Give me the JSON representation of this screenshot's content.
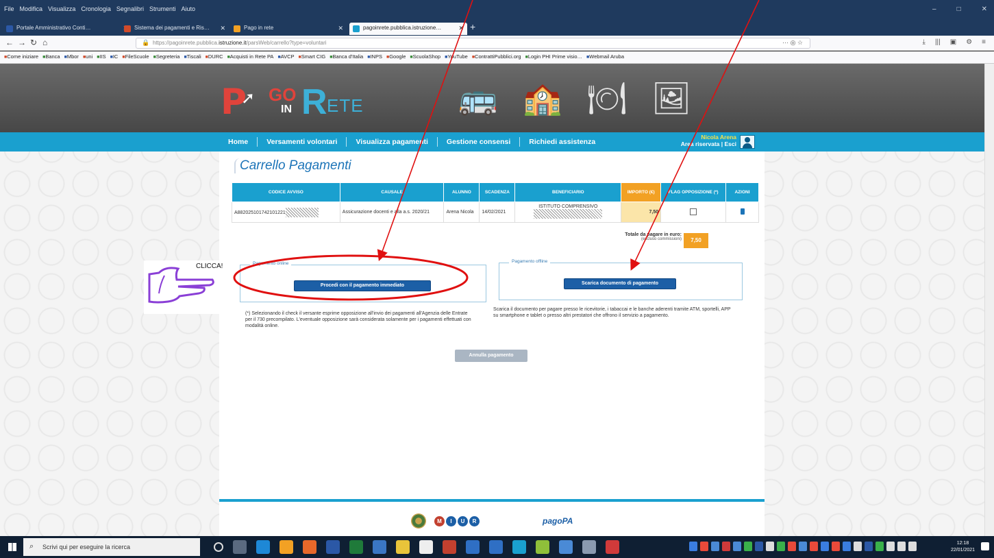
{
  "browser": {
    "menu": [
      "File",
      "Modifica",
      "Visualizza",
      "Cronologia",
      "Segnalibri",
      "Strumenti",
      "Aiuto"
    ],
    "window_controls": [
      "–",
      "□",
      "✕"
    ],
    "tabs": [
      {
        "title": "Portale Amministrativo Conti…",
        "color": "#2b58a6"
      },
      {
        "title": "Sistema dei pagamenti e Ris…",
        "color": "#d04a2a"
      },
      {
        "title": "Pago in rete",
        "color": "#f2a124"
      },
      {
        "title": "pagoinrete.pubblica.istruzione…",
        "color": "#1aa0cf"
      }
    ],
    "url_prefix": "https://pagoinrete.pubblica.",
    "url_host": "istruzione.it",
    "url_path": "/parsWeb/carrello?type=voluntari",
    "url_more": "··· ◎ ☆",
    "nav_right": [
      "⤓",
      "|||",
      "▣",
      "⚙",
      "≡"
    ],
    "bookmarks": [
      "Come iniziare",
      "Banca",
      "Mbor",
      "uni",
      "IIS",
      "IC",
      "FileScuole",
      "Segreteria",
      "Tiscali",
      "DURC",
      "Acquisti in Rete PA",
      "AVCP",
      "Smart CIG",
      "Banca d'Italia",
      "INPS",
      "Google",
      "ScuolaShop",
      "YouTube",
      "ContrattiPubblici.org",
      "Login PHI Prime visio…",
      "Webmail Aruba"
    ]
  },
  "site": {
    "nav": [
      "Home",
      "Versamenti volontari",
      "Visualizza pagamenti",
      "Gestione consensi",
      "Richiedi assistenza"
    ],
    "user_name": "Nicola Arena",
    "user_area": "Area riservata | Esci"
  },
  "cart": {
    "title": "Carrello Pagamenti",
    "columns": [
      "Codice avviso",
      "Causale",
      "Alunno",
      "Scadenza",
      "Beneficiario",
      "Importo (€)",
      "Flag opposizione (*)",
      "Azioni"
    ],
    "rows": [
      {
        "codice": "A882025101742101221",
        "causale": "Assicurazione docenti e alla a.s. 2020/21",
        "alunno": "Arena Nicola",
        "scadenza": "14/02/2021",
        "beneficiario": "ISTITUTO COMPRENSIVO",
        "importo": "7,50"
      }
    ],
    "total_label": "Totale da pagare in euro:",
    "total_note": "(escluso commissioni)",
    "total_value": "7,50"
  },
  "payment": {
    "online_legend": "Pagamento online",
    "online_button": "Procedi con il pagamento immediato",
    "online_text": "(*) Selezionando il check il versante esprime opposizione all'invio dei pagamenti all'Agenzia delle Entrate per il 730 precompilato. L'eventuale opposizione sarà considerata solamente per i pagamenti effettuati con modalità online.",
    "offline_legend": "Pagamento offline",
    "offline_button": "Scarica documento di pagamento",
    "offline_text": "Scarica il documento per pagare presso le ricevitorie, i tabaccai e le banche aderenti tramite ATM, sportelli, APP su smartphone e tablet o presso altri prestatori che offrono il servizio a pagamento.",
    "cancel_button": "Annulla pagamento"
  },
  "footer": {
    "mi_letters": [
      "M",
      "I",
      "U",
      "R"
    ],
    "pagopa": "pagoPA"
  },
  "annotation": {
    "callout_text": "CLICCA!",
    "arrow_color": "#e01010",
    "hand_color": "#8a3fd6"
  },
  "taskbar": {
    "search_placeholder": "Scrivi qui per eseguire la ricerca",
    "time": "12:18",
    "date": "22/01/2021"
  },
  "colors": {
    "brand_blue": "#1aa0cf",
    "brand_orange": "#f2a124",
    "button_blue": "#1c5fa6"
  }
}
